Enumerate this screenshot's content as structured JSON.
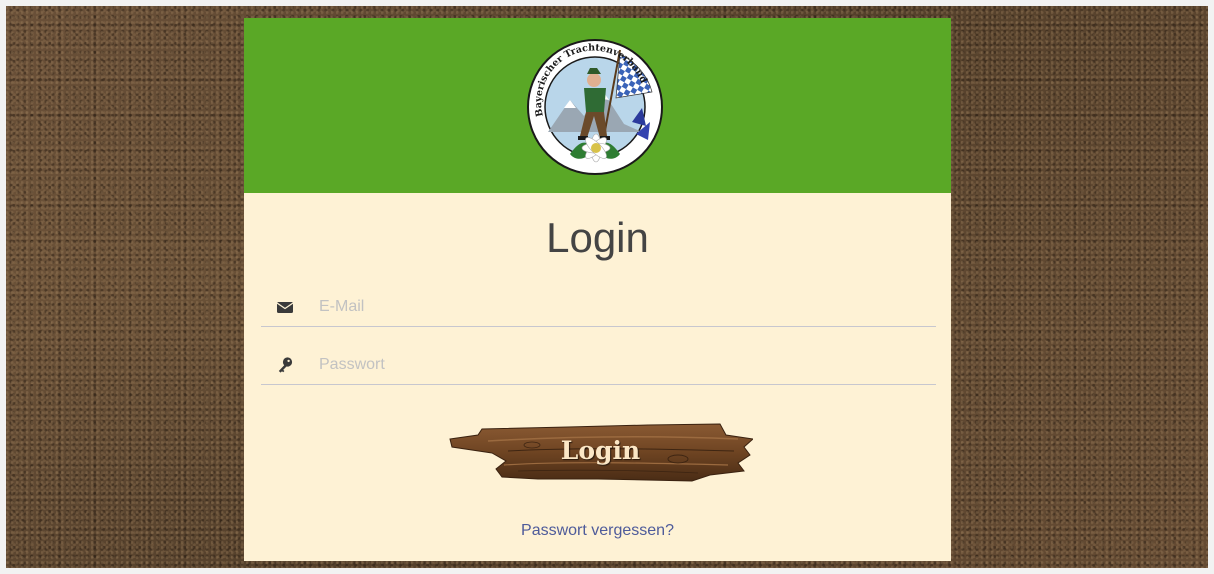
{
  "login_form": {
    "title": "Login",
    "email": {
      "placeholder": "E-Mail",
      "value": "",
      "icon": "envelope-icon"
    },
    "password": {
      "placeholder": "Passwort",
      "value": "",
      "icon": "key-icon"
    },
    "submit_label": "Login",
    "forgot_password_label": "Passwort vergessen?"
  },
  "logo": {
    "text": "Bayerischer Trachtenverband e.V."
  },
  "colors": {
    "header_green": "#5aa826",
    "card_background": "#fef2d5",
    "link": "#4e5b9a",
    "title_text": "#444444"
  }
}
